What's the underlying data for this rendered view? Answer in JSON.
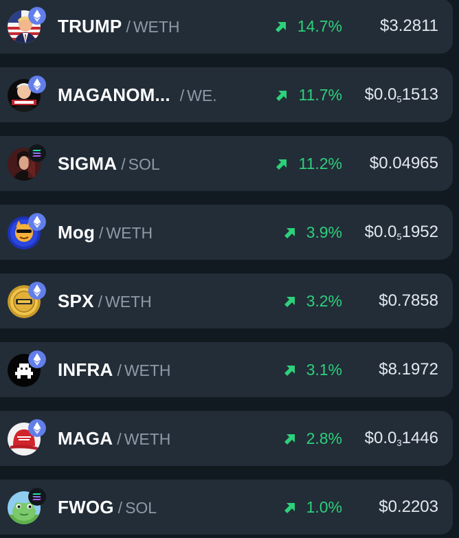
{
  "colors": {
    "background": "#111a21",
    "row_background": "#222d38",
    "positive": "#2dd17a",
    "symbol": "#ffffff",
    "quote": "#8e9aa8",
    "price": "#e4e8ee",
    "eth_badge": "#627eea",
    "sol_badge": "#12171c"
  },
  "rows": [
    {
      "symbol": "TRUMP",
      "quote": "WETH",
      "change": "14.7%",
      "price_prefix": "$3.2811",
      "price_sub": "",
      "price_suffix": "",
      "chain_icon": "ethereum-icon",
      "avatar_icon": "trump-avatar-icon"
    },
    {
      "symbol": "MAGANOM...",
      "quote": "WE.",
      "change": "11.7%",
      "price_prefix": "$0.0",
      "price_sub": "5",
      "price_suffix": "1513",
      "chain_icon": "ethereum-icon",
      "avatar_icon": "maganomics-avatar-icon"
    },
    {
      "symbol": "SIGMA",
      "quote": "SOL",
      "change": "11.2%",
      "price_prefix": "$0.04965",
      "price_sub": "",
      "price_suffix": "",
      "chain_icon": "solana-icon",
      "avatar_icon": "sigma-avatar-icon"
    },
    {
      "symbol": "Mog",
      "quote": "WETH",
      "change": "3.9%",
      "price_prefix": "$0.0",
      "price_sub": "5",
      "price_suffix": "1952",
      "chain_icon": "ethereum-icon",
      "avatar_icon": "mog-cat-avatar-icon"
    },
    {
      "symbol": "SPX",
      "quote": "WETH",
      "change": "3.2%",
      "price_prefix": "$0.7858",
      "price_sub": "",
      "price_suffix": "",
      "chain_icon": "ethereum-icon",
      "avatar_icon": "spx-coin-avatar-icon"
    },
    {
      "symbol": "INFRA",
      "quote": "WETH",
      "change": "3.1%",
      "price_prefix": "$8.1972",
      "price_sub": "",
      "price_suffix": "",
      "chain_icon": "ethereum-icon",
      "avatar_icon": "infra-robot-avatar-icon"
    },
    {
      "symbol": "MAGA",
      "quote": "WETH",
      "change": "2.8%",
      "price_prefix": "$0.0",
      "price_sub": "3",
      "price_suffix": "1446",
      "chain_icon": "ethereum-icon",
      "avatar_icon": "maga-hat-avatar-icon"
    },
    {
      "symbol": "FWOG",
      "quote": "SOL",
      "change": "1.0%",
      "price_prefix": "$0.2203",
      "price_sub": "",
      "price_suffix": "",
      "chain_icon": "solana-icon",
      "avatar_icon": "fwog-frog-avatar-icon"
    }
  ]
}
